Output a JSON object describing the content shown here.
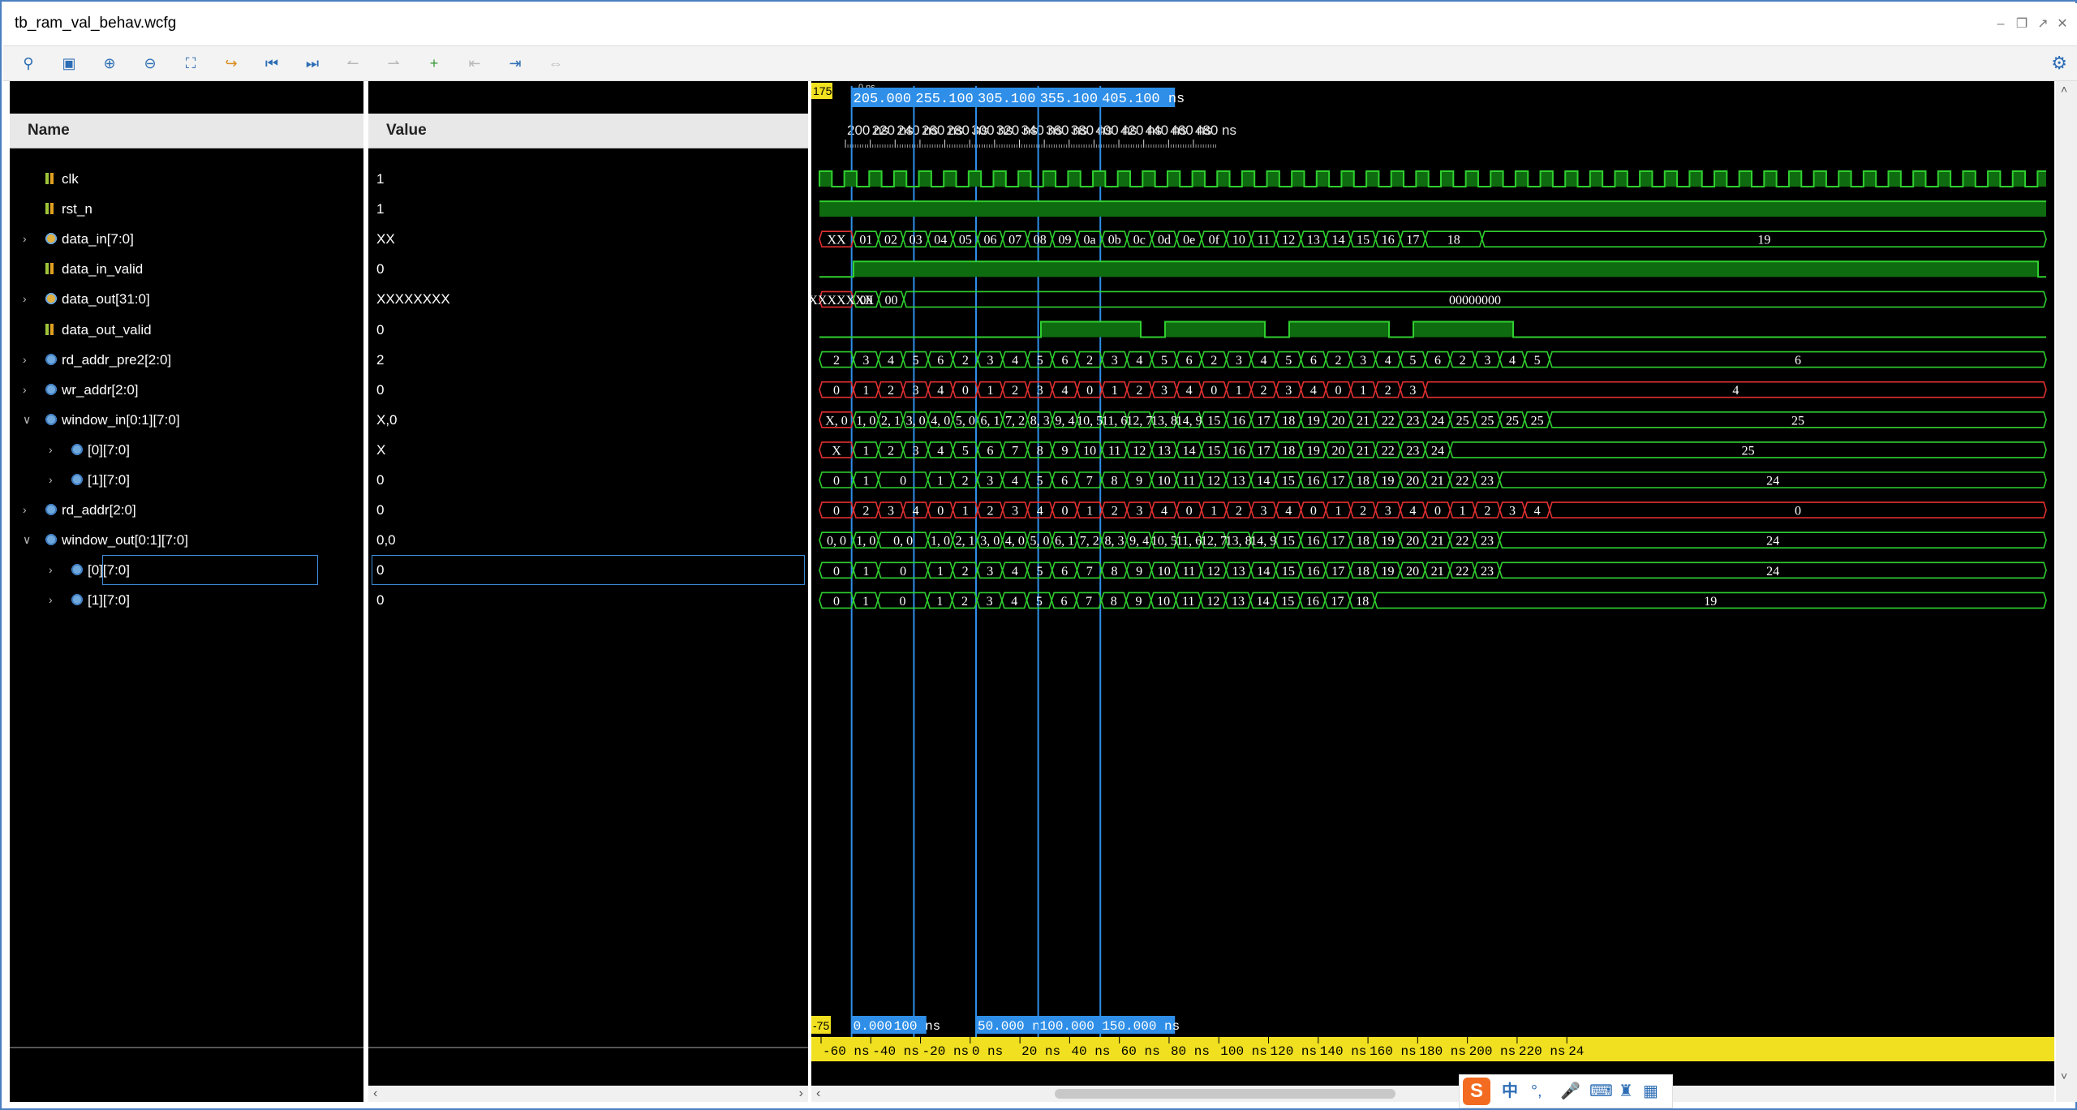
{
  "window": {
    "title": "tb_ram_val_behav.wcfg"
  },
  "toolbar": {
    "icons": [
      "search-icon",
      "save-icon",
      "zoom-in-icon",
      "zoom-out-icon",
      "zoom-fit-icon",
      "go-to-cursor-icon",
      "go-to-start-icon",
      "go-to-end-icon",
      "previous-transition-icon",
      "next-transition-icon",
      "add-marker-icon",
      "previous-marker-icon",
      "next-marker-icon",
      "swap-cursors-icon"
    ],
    "settings_icon": "gear-icon"
  },
  "columns": {
    "name": "Name",
    "value": "Value"
  },
  "signals": [
    {
      "name": "clk",
      "value": "1",
      "indent": 0,
      "expander": "",
      "icon": "scalar"
    },
    {
      "name": "rst_n",
      "value": "1",
      "indent": 0,
      "expander": "",
      "icon": "scalar"
    },
    {
      "name": "data_in[7:0]",
      "value": "XX",
      "indent": 0,
      "expander": ">",
      "icon": "busin"
    },
    {
      "name": "data_in_valid",
      "value": "0",
      "indent": 0,
      "expander": "",
      "icon": "scalar"
    },
    {
      "name": "data_out[31:0]",
      "value": "XXXXXXXX",
      "indent": 0,
      "expander": ">",
      "icon": "busin"
    },
    {
      "name": "data_out_valid",
      "value": "0",
      "indent": 0,
      "expander": "",
      "icon": "scalar"
    },
    {
      "name": "rd_addr_pre2[2:0]",
      "value": "2",
      "indent": 0,
      "expander": ">",
      "icon": "bus"
    },
    {
      "name": "wr_addr[2:0]",
      "value": "0",
      "indent": 0,
      "expander": ">",
      "icon": "bus"
    },
    {
      "name": "window_in[0:1][7:0]",
      "value": "X,0",
      "indent": 0,
      "expander": "v",
      "icon": "bus"
    },
    {
      "name": "[0][7:0]",
      "value": "X",
      "indent": 1,
      "expander": ">",
      "icon": "bus"
    },
    {
      "name": "[1][7:0]",
      "value": "0",
      "indent": 1,
      "expander": ">",
      "icon": "bus"
    },
    {
      "name": "rd_addr[2:0]",
      "value": "0",
      "indent": 0,
      "expander": ">",
      "icon": "bus"
    },
    {
      "name": "window_out[0:1][7:0]",
      "value": "0,0",
      "indent": 0,
      "expander": "v",
      "icon": "bus"
    },
    {
      "name": "[0][7:0]",
      "value": "0",
      "indent": 1,
      "expander": ">",
      "icon": "bus",
      "selected": true
    },
    {
      "name": "[1][7:0]",
      "value": "0",
      "indent": 1,
      "expander": ">",
      "icon": "bus"
    }
  ],
  "timeline": {
    "top_left_flag": "175",
    "top_left_small": "0 ns",
    "markers_top": [
      "205.000 ns",
      "255.100 ns",
      "305.100 ns",
      "355.100 ns",
      "405.100 ns"
    ],
    "ticks_top": [
      "200 ns",
      "220 ns",
      "240 ns",
      "260 ns",
      "280 ns",
      "300 ns",
      "320 ns",
      "340 ns",
      "360 ns",
      "380 ns",
      "400 ns",
      "420 ns",
      "440 ns",
      "460 ns",
      "480 ns"
    ],
    "bottom_left_flag": "-75",
    "markers_bottom": [
      "0.000 ns",
      "100 ns",
      "50.000 ns",
      "100.000 ns",
      "150.000 ns"
    ],
    "ticks_bottom": [
      "-60 ns",
      "-40 ns",
      "-20 ns",
      "0 ns",
      "20 ns",
      "40 ns",
      "60 ns",
      "80 ns",
      "100 ns",
      "120 ns",
      "140 ns",
      "160 ns",
      "180 ns",
      "200 ns",
      "220 ns",
      "24"
    ]
  },
  "waves": {
    "data_in": [
      "XX",
      "01",
      "02",
      "03",
      "04",
      "05",
      "06",
      "07",
      "08",
      "09",
      "0a",
      "0b",
      "0c",
      "0d",
      "0e",
      "0f",
      "10",
      "11",
      "12",
      "13",
      "14",
      "15",
      "16",
      "17",
      "18",
      "19"
    ],
    "data_out_labels": [
      "XXXXXXXX",
      "00",
      "00",
      "00000000"
    ],
    "rd_addr_pre2": [
      "2",
      "3",
      "4",
      "5",
      "6",
      "2",
      "3",
      "4",
      "5",
      "6",
      "2",
      "3",
      "4",
      "5",
      "6",
      "2",
      "3",
      "4",
      "5",
      "6",
      "2",
      "3",
      "4",
      "5",
      "6",
      "2",
      "3",
      "4",
      "5",
      "6"
    ],
    "wr_addr": [
      "0",
      "1",
      "2",
      "3",
      "4",
      "0",
      "1",
      "2",
      "3",
      "4",
      "0",
      "1",
      "2",
      "3",
      "4",
      "0",
      "1",
      "2",
      "3",
      "4",
      "0",
      "1",
      "2",
      "3",
      "4"
    ],
    "window_in": [
      "X, 0",
      "1, 0",
      "2, 1",
      "3, 0",
      "4, 0",
      "5, 0",
      "6, 1",
      "7, 2",
      "8, 3",
      "9, 4",
      "10, 5",
      "11, 6",
      "12, 7",
      "13, 8",
      "14, 9",
      "15",
      "16",
      "17",
      "18",
      "19",
      "20",
      "21",
      "22",
      "23",
      "24",
      "25",
      "25",
      "25",
      "25",
      "25"
    ],
    "window_in0": [
      "X",
      "1",
      "2",
      "3",
      "4",
      "5",
      "6",
      "7",
      "8",
      "9",
      "10",
      "11",
      "12",
      "13",
      "14",
      "15",
      "16",
      "17",
      "18",
      "19",
      "20",
      "21",
      "22",
      "23",
      "24",
      "25"
    ],
    "window_in1": [
      "0",
      "1",
      "0",
      "1",
      "2",
      "3",
      "4",
      "5",
      "6",
      "7",
      "8",
      "9",
      "10",
      "11",
      "12",
      "13",
      "14",
      "15",
      "16",
      "17",
      "18",
      "19",
      "20",
      "21",
      "22",
      "23",
      "24"
    ],
    "rd_addr": [
      "0",
      "2",
      "3",
      "4",
      "0",
      "1",
      "2",
      "3",
      "4",
      "0",
      "1",
      "2",
      "3",
      "4",
      "0",
      "1",
      "2",
      "3",
      "4",
      "0",
      "1",
      "2",
      "3",
      "4",
      "0",
      "1",
      "2",
      "3",
      "4",
      "0"
    ],
    "window_out": [
      "0, 0",
      "1, 0",
      "0, 0",
      "1, 0",
      "2, 1",
      "3, 0",
      "4, 0",
      "5, 0",
      "6, 1",
      "7, 2",
      "8, 3",
      "9, 4",
      "10, 5",
      "11, 6",
      "12, 7",
      "13, 8",
      "14, 9",
      "15",
      "16",
      "17",
      "18",
      "19",
      "20",
      "21",
      "22",
      "23",
      "24"
    ],
    "window_out0": [
      "0",
      "1",
      "0",
      "1",
      "2",
      "3",
      "4",
      "5",
      "6",
      "7",
      "8",
      "9",
      "10",
      "11",
      "12",
      "13",
      "14",
      "15",
      "16",
      "17",
      "18",
      "19",
      "20",
      "21",
      "22",
      "23",
      "24"
    ],
    "window_out1": [
      "0",
      "1",
      "0",
      "1",
      "2",
      "3",
      "4",
      "5",
      "6",
      "7",
      "8",
      "9",
      "10",
      "11",
      "12",
      "13",
      "14",
      "15",
      "16",
      "17",
      "18",
      "19"
    ]
  },
  "ime": {
    "logo": "S",
    "items": [
      "中",
      "°,",
      "mic-icon",
      "keyboard-icon",
      "shirt-icon",
      "grid-icon"
    ]
  }
}
